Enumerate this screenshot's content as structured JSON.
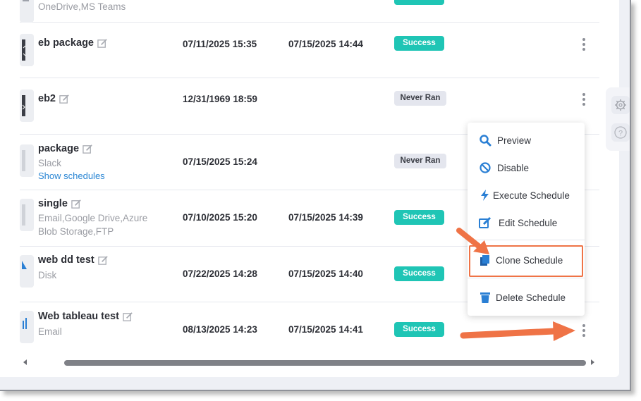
{
  "rows": [
    {
      "name": "",
      "subtitle": "OneDrive,MS Teams",
      "created": "",
      "last_run": "",
      "status": ""
    },
    {
      "name": "eb package",
      "created": "07/11/2025 15:35",
      "last_run": "07/15/2025 14:44",
      "status": "Success"
    },
    {
      "name": "eb2",
      "created": "12/31/1969 18:59",
      "last_run": "",
      "status": "Never Ran"
    },
    {
      "name": "package",
      "subtitle": "Slack",
      "link": "Show schedules",
      "created": "07/15/2025 15:24",
      "last_run": "",
      "status": "Never Ran"
    },
    {
      "name": "single",
      "subtitle_lines": [
        "Email,Google Drive,Azure",
        "Blob Storage,FTP"
      ],
      "created": "07/10/2025 15:20",
      "last_run": "07/15/2025 14:39",
      "status": "Success"
    },
    {
      "name": "web dd test",
      "subtitle": "Disk",
      "created": "07/22/2025 14:28",
      "last_run": "07/15/2025 14:40",
      "status": "Success"
    },
    {
      "name": "Web tableau test",
      "subtitle": "Email",
      "created": "08/13/2025 14:23",
      "last_run": "07/15/2025 14:41",
      "status": "Success"
    }
  ],
  "context_menu": {
    "items": [
      {
        "label": "Preview",
        "icon": "search-icon"
      },
      {
        "label": "Disable",
        "icon": "ban-icon"
      },
      {
        "label": "Execute Schedule",
        "icon": "bolt-icon"
      },
      {
        "label": "Edit Schedule",
        "icon": "edit-icon"
      },
      {
        "label": "Clone Schedule",
        "icon": "clone-icon"
      },
      {
        "label": "Delete Schedule",
        "icon": "trash-icon"
      }
    ],
    "highlighted": "Clone Schedule"
  },
  "side_panel": {
    "icons": [
      "gear-icon",
      "help-icon"
    ]
  },
  "colors": {
    "success": "#1fc5b5",
    "never_ran": "#e4e6ee",
    "menu_icon_blue": "#2a7fd4",
    "annotation_orange": "#ef7346",
    "link": "#2a86d4"
  }
}
